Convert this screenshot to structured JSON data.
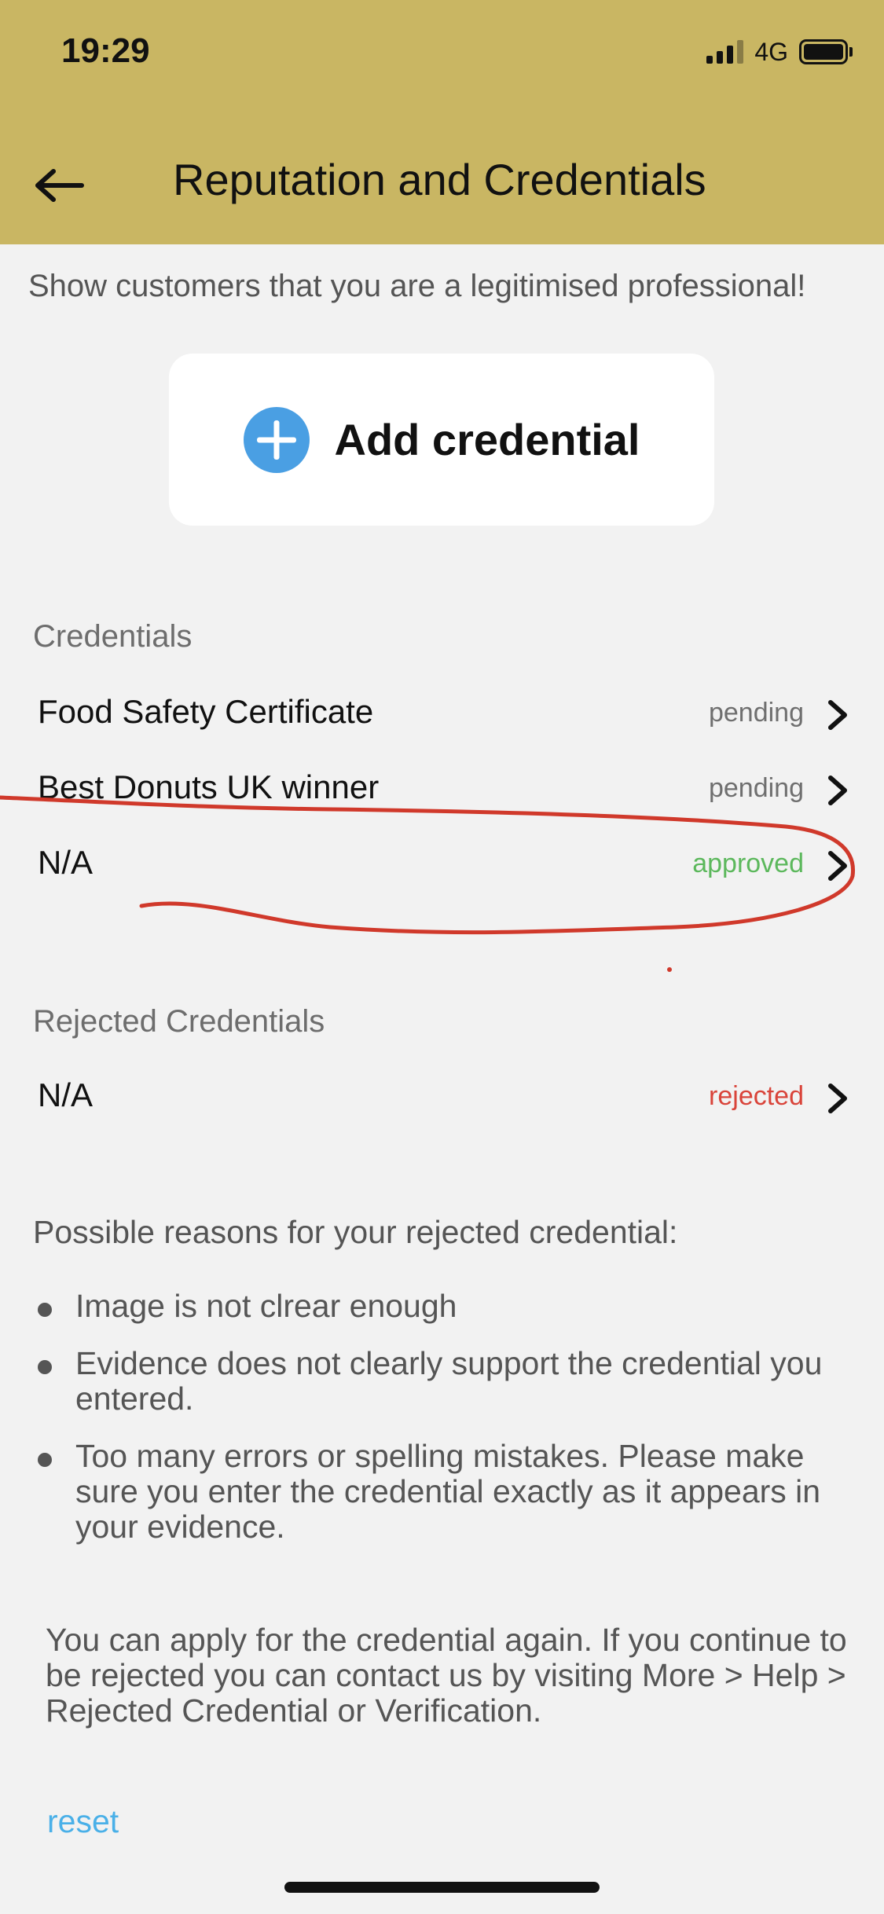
{
  "status_bar": {
    "time": "19:29",
    "network": "4G"
  },
  "header": {
    "title": "Reputation and Credentials",
    "background_color": "#c9b663"
  },
  "subtitle": "Show customers that you are a legitimised professional!",
  "add_credential": {
    "label": "Add credential",
    "icon": "plus-circle-icon",
    "accent_color": "#4a9fe3"
  },
  "credentials": {
    "title": "Credentials",
    "items": [
      {
        "name": "Food Safety Certificate",
        "status": "pending"
      },
      {
        "name": "Best Donuts UK winner",
        "status": "pending"
      },
      {
        "name": "N/A",
        "status": "approved"
      }
    ]
  },
  "rejected": {
    "title": "Rejected Credentials",
    "items": [
      {
        "name": "N/A",
        "status": "rejected"
      }
    ]
  },
  "status_colors": {
    "pending": "#6f6f6f",
    "approved": "#5cb85c",
    "rejected": "#d9443a"
  },
  "reasons": {
    "title": "Possible reasons for your rejected credential:",
    "items": [
      "Image is not clrear enough",
      "Evidence does not clearly support the credential you entered.",
      "Too many errors or spelling mistakes. Please make sure you enter the credential exactly as it appears in your evidence."
    ]
  },
  "reapply_note": "You can apply for the credential again. If you continue to be rejected you can contact us by visiting More > Help > Rejected Credential or Verification.",
  "reset_label": "reset",
  "annotation_color": "#d0392b"
}
